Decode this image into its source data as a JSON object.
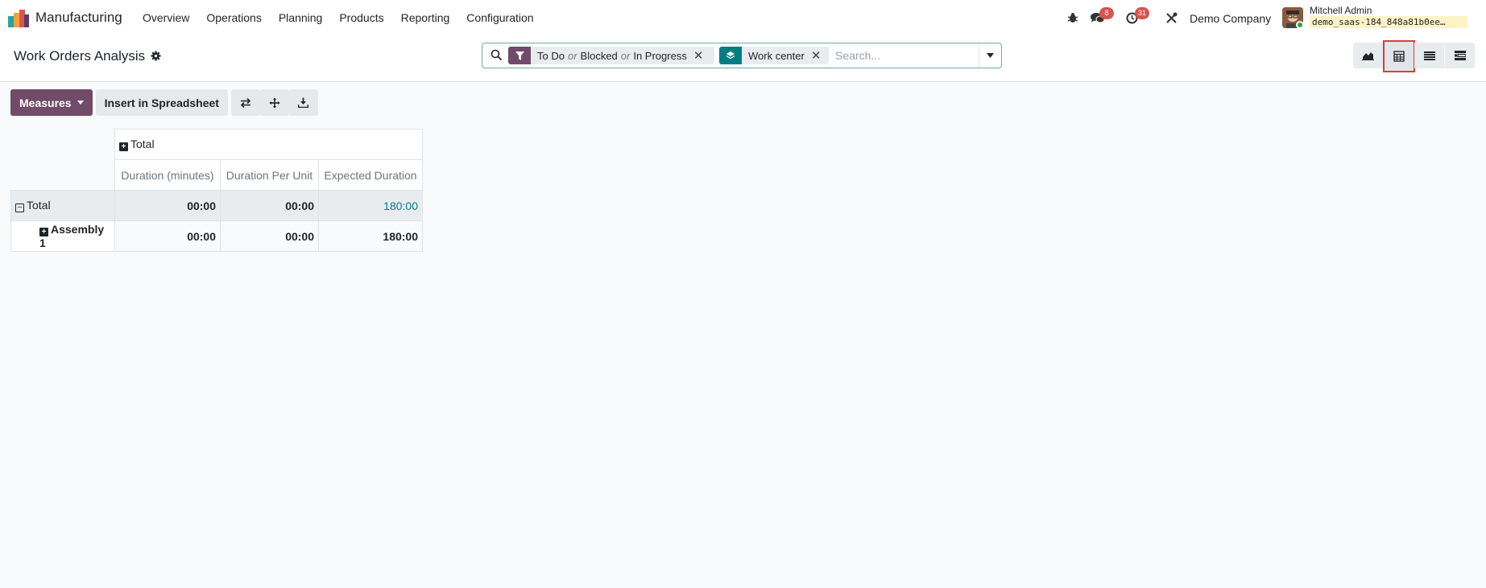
{
  "navbar": {
    "app_name": "Manufacturing",
    "menu": [
      "Overview",
      "Operations",
      "Planning",
      "Products",
      "Reporting",
      "Configuration"
    ],
    "messages_badge": "8",
    "activities_badge": "31",
    "company": "Demo Company",
    "user_name": "Mitchell Admin",
    "db_name": "demo_saas-184_848a81b0ee…"
  },
  "control_panel": {
    "title": "Work Orders Analysis",
    "facets": {
      "filter": {
        "v1": "To Do",
        "or1": "or",
        "v2": "Blocked",
        "or2": "or",
        "v3": "In Progress"
      },
      "groupby": {
        "label": "Work center"
      }
    },
    "search_placeholder": "Search..."
  },
  "toolbar": {
    "measures": "Measures",
    "insert_spreadsheet": "Insert in Spreadsheet"
  },
  "pivot": {
    "col_header": "Total",
    "measures": [
      "Duration (minutes)",
      "Duration Per Unit",
      "Expected Duration"
    ],
    "rows": [
      {
        "label": "Total",
        "values": [
          "00:00",
          "00:00",
          "180:00"
        ]
      },
      {
        "label": "Assembly 1",
        "values": [
          "00:00",
          "00:00",
          "180:00"
        ]
      }
    ]
  },
  "colors": {
    "brand": "#714b67",
    "teal": "#017e84",
    "badge": "#d9534f"
  }
}
